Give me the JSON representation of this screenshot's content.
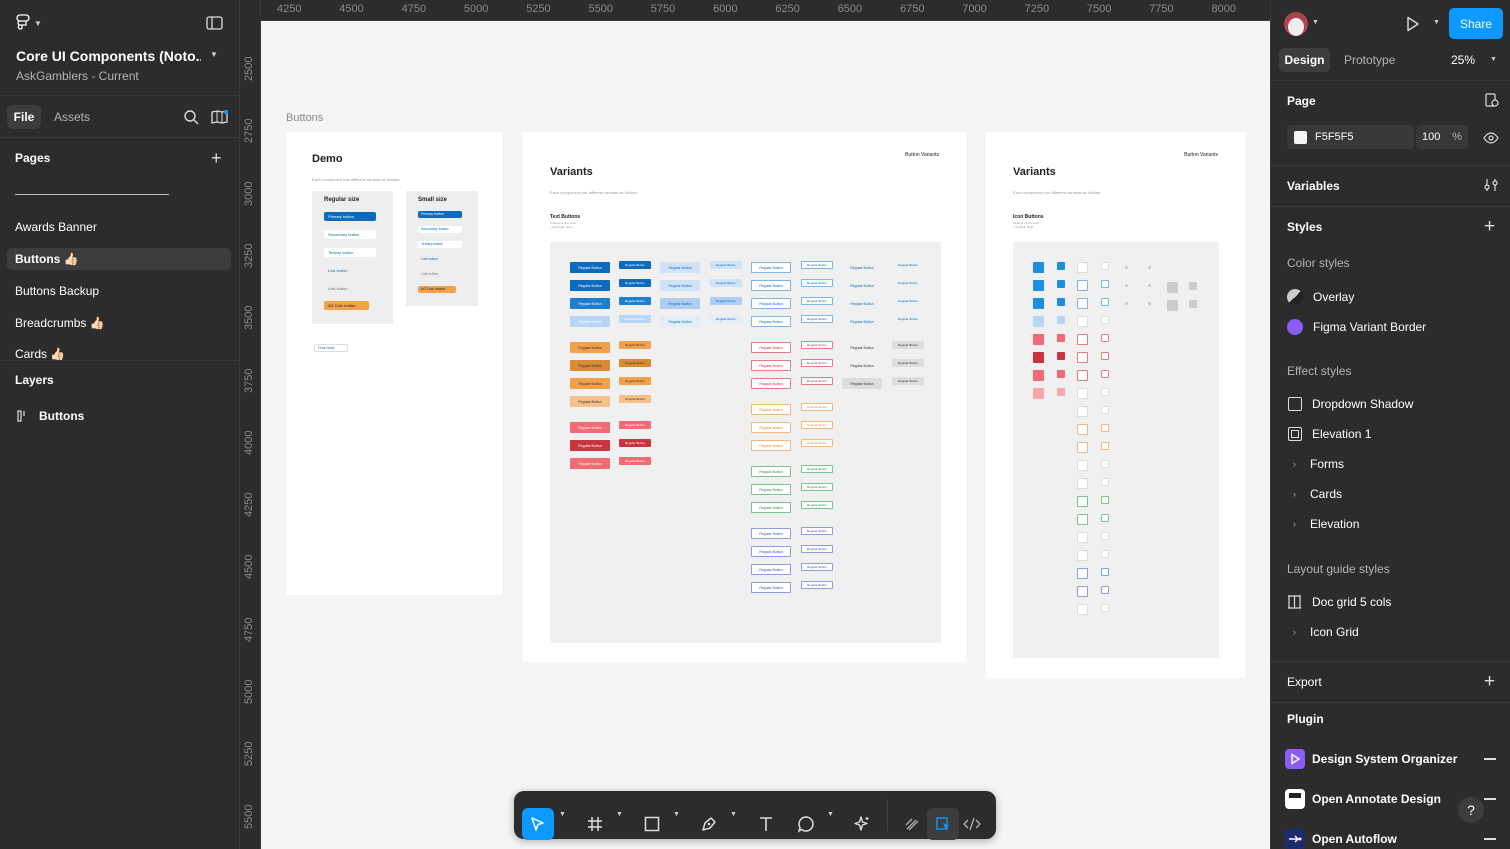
{
  "file": {
    "title": "Core UI Components (Noto...",
    "project": "AskGamblers - Current"
  },
  "left_tabs": {
    "file": "File",
    "assets": "Assets"
  },
  "pages": {
    "heading": "Pages",
    "items": [
      {
        "label": "Awards Banner"
      },
      {
        "label": "Buttons 👍🏻"
      },
      {
        "label": "Buttons Backup"
      },
      {
        "label": "Breadcrumbs 👍🏻"
      },
      {
        "label": "Cards 👍🏻"
      }
    ]
  },
  "layers": {
    "heading": "Layers",
    "items": [
      {
        "label": "Buttons"
      }
    ]
  },
  "ruler": {
    "x": [
      "4250",
      "4500",
      "4750",
      "5000",
      "5250",
      "5500",
      "5750",
      "6000",
      "6250",
      "6500",
      "6750",
      "7000",
      "7250",
      "7500",
      "7750",
      "8000"
    ],
    "y": [
      "2500",
      "2750",
      "3000",
      "3250",
      "3500",
      "3750",
      "4000",
      "4250",
      "4500",
      "4750",
      "5000",
      "5250",
      "5500"
    ]
  },
  "canvas": {
    "section_label": "Buttons",
    "demo": {
      "title": "Demo",
      "desc": "Each component has different variants as follows:",
      "regular_size": "Regular size",
      "small_size": "Small size",
      "regular_buttons": [
        "Primary button",
        "Secondary button",
        "Tertiary button",
        "Link button",
        "Link button",
        "AG Coin button"
      ],
      "small_buttons": [
        "Primary button",
        "Secondary button",
        "Tertiary button",
        "Link button",
        "Link button",
        "AG Coin button"
      ],
      "chat_button": "Chat Now!"
    },
    "variants1": {
      "title": "Variants",
      "tag": "Button Variants",
      "desc": "Each component has different variants as follows:",
      "sub": "Text Buttons",
      "sub_note": "Change at the level\n• Icon/right: none",
      "btn_text": "Regular Button"
    },
    "variants2": {
      "title": "Variants",
      "tag": "Button Variants",
      "desc": "Each component has different variants as follows:",
      "sub": "Icon Buttons",
      "sub_note": "Change at the level\n• Icon/left: Style"
    }
  },
  "right": {
    "tabs": {
      "design": "Design",
      "prototype": "Prototype"
    },
    "zoom": "25%",
    "share": "Share",
    "page": {
      "heading": "Page",
      "color": "F5F5F5",
      "opacity": "100",
      "pct": "%"
    },
    "variables": "Variables",
    "styles": {
      "heading": "Styles",
      "color_heading": "Color styles",
      "colors": [
        {
          "label": "Overlay"
        },
        {
          "label": "Figma Variant Border"
        }
      ],
      "effect_heading": "Effect styles",
      "effects": [
        {
          "label": "Dropdown Shadow"
        },
        {
          "label": "Elevation 1"
        }
      ],
      "effect_groups": [
        {
          "label": "Forms"
        },
        {
          "label": "Cards"
        },
        {
          "label": "Elevation"
        }
      ],
      "layout_heading": "Layout guide styles",
      "layouts": [
        {
          "label": "Doc grid 5 cols"
        }
      ],
      "layout_groups": [
        {
          "label": "Icon Grid"
        }
      ]
    },
    "export": "Export",
    "plugin": {
      "heading": "Plugin",
      "items": [
        {
          "label": "Design System Organizer"
        },
        {
          "label": "Open Annotate Design"
        },
        {
          "label": "Open Autoflow"
        }
      ]
    },
    "help": "?"
  },
  "colors": {
    "accent": "#0d99ff",
    "panel": "#2c2c2c",
    "canvas": "#f5f5f5",
    "primary_btn": "#0c6bbd",
    "coin": "#f2a04a",
    "purple": "#8b5cf6"
  }
}
